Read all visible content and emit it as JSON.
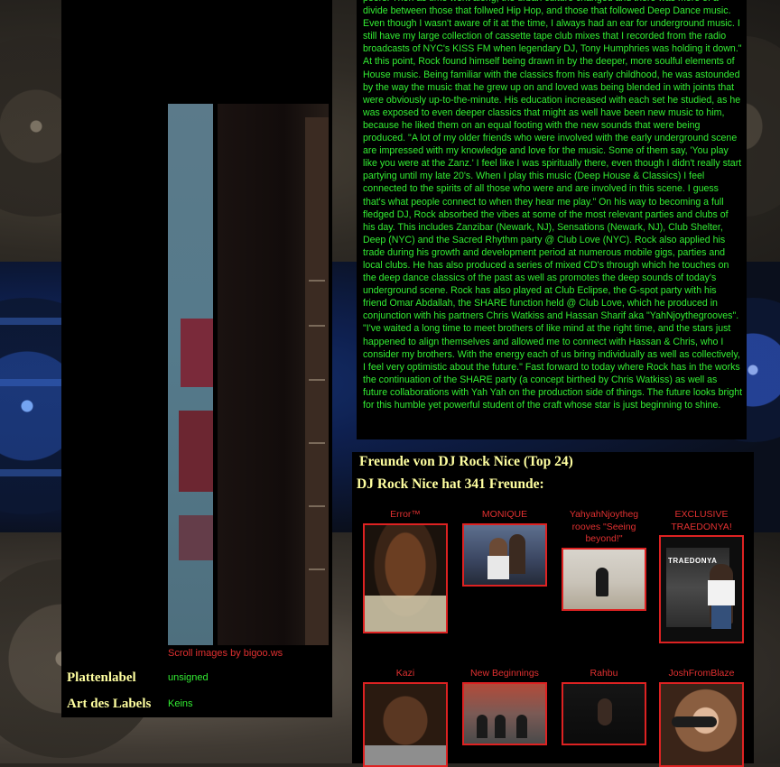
{
  "profile": {
    "bio": "peers. Then as time went along, the urban culture changed and there was more of a divide between those that follwed Hip Hop, and those that followed Deep Dance music. Even though I wasn't aware of it at the time, I always had an ear for underground music. I still have my large collection of cassette tape club mixes that I recorded from the radio broadcasts of NYC's KISS FM when legendary DJ, Tony Humphries was holding it down.\" At this point, Rock found himself being drawn in by the deeper, more soulful elements of House music. Being familiar with the classics from his early childhood, he was astounded by the way the music that he grew up on and loved was being blended in with joints that were obviously up-to-the-minute. His education increased with each set he studied, as he was exposed to even deeper classics that might as well have been new music to him, because he liked them on an equal footing with the new sounds that were being produced. \"A lot of my older friends who were involved with the early underground scene are impressed with my knowledge and love for the music. Some of them say, 'You play like you were at the Zanz.' I feel like I was spiritually there, even though I didn't really start partying until my late 20's. When I play this music (Deep House & Classics) I feel connected to the spirits of all those who were and are involved in this scene. I guess that's what people connect to when they hear me play.\" On his way to becoming a full fledged DJ, Rock absorbed the vibes at some of the most relevant parties and clubs of his day. This includes Zanzibar (Newark, NJ), Sensations (Newark, NJ), Club Shelter, Deep (NYC) and the Sacred Rhythm party @ Club Love (NYC). Rock also applied his trade during his growth and development period at numerous mobile gigs, parties and local clubs. He has also produced a series of mixed CD's through which he touches on the deep dance classics of the past as well as promotes the deep sounds of today's underground scene. Rock has also played at Club Eclipse, the G-spot party with his friend Omar Abdallah, the SHARE function held @ Club Love, which he produced in conjunction with his partners Chris Watkiss and Hassan Sharif aka \"YahNjoythegrooves\". \"I've waited a long time to meet brothers of like mind at the right time, and the stars just happened to align themselves and allowed me to connect with Hassan & Chris, who I consider my brothers. With the energy each of us bring individually as well as collectively, I feel very optimistic about the future.\" Fast forward to today where Rock has in the works the continuation of the SHARE party (a concept birthed by Chris Watkiss) as well as future collaborations with Yah Yah on the production side of things. The future looks bright for this humble yet powerful student of the craft whose star is just beginning to shine."
  },
  "slider": {
    "credit": "Scroll images by bigoo.ws"
  },
  "label_info": {
    "label_title": "Plattenlabel",
    "label_value": "unsigned",
    "type_title": "Art des Labels",
    "type_value": "Keins"
  },
  "friends": {
    "heading": "Freunde von DJ Rock Nice (Top 24)",
    "count_text": "DJ Rock Nice hat 341 Freunde:",
    "list": [
      {
        "name": "Error™",
        "icon": "portrait-photo"
      },
      {
        "name": "MONIQUE",
        "icon": "portrait-photo"
      },
      {
        "name": "YahyahNjoytheg rooves \"Seeing beyond!\"",
        "icon": "portrait-photo"
      },
      {
        "name": "EXCLUSIVE TRAEDONYA!",
        "icon": "poster-photo",
        "poster_title": "TRAEDONYA"
      },
      {
        "name": "Kazi",
        "icon": "portrait-photo"
      },
      {
        "name": "New Beginnings",
        "icon": "group-photo"
      },
      {
        "name": "Rahbu",
        "icon": "portrait-photo"
      },
      {
        "name": "JoshFromBlaze",
        "icon": "portrait-photo"
      }
    ]
  },
  "colors": {
    "bio_text": "#33ee33",
    "friend_name": "#e03030",
    "photo_border": "#dd2222",
    "heading": "#ffffa0"
  }
}
